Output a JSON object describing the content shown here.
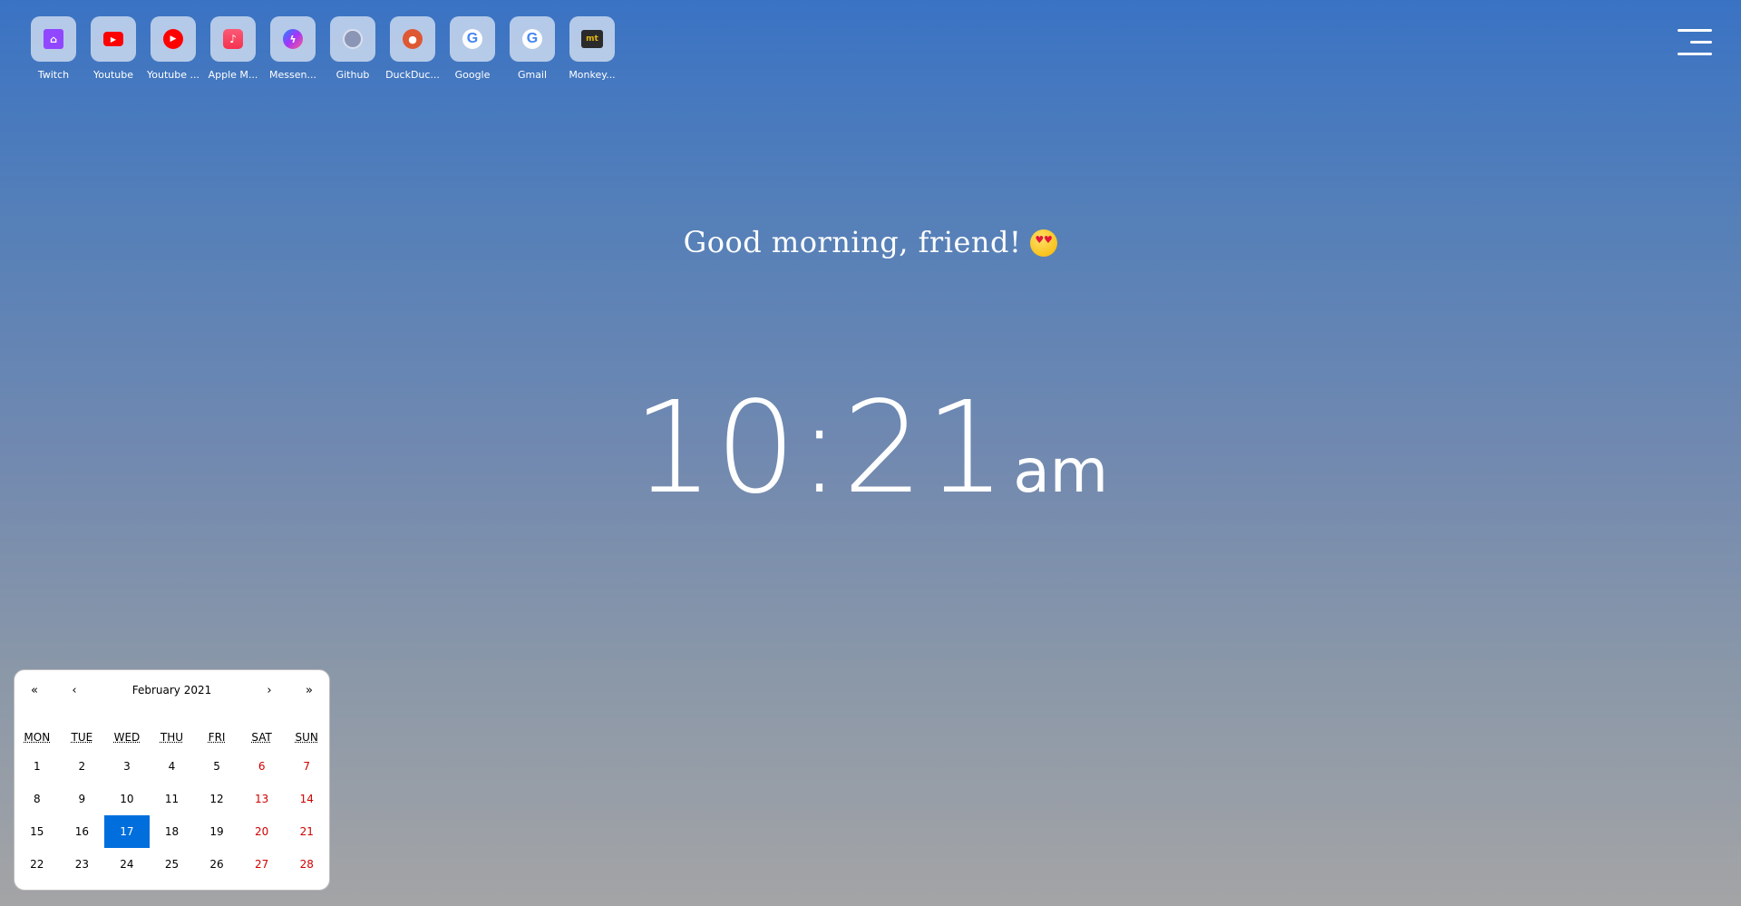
{
  "shortcuts": [
    {
      "label": "Twitch",
      "icon": "twitch-icon",
      "glyph": "⌂"
    },
    {
      "label": "Youtube",
      "icon": "youtube-icon",
      "glyph": "▶"
    },
    {
      "label": "Youtube ...",
      "icon": "youtube-music-icon",
      "glyph": "▶"
    },
    {
      "label": "Apple M...",
      "icon": "apple-music-icon",
      "glyph": "♪"
    },
    {
      "label": "Messen...",
      "icon": "messenger-icon",
      "glyph": "ϟ"
    },
    {
      "label": "Github",
      "icon": "github-icon",
      "glyph": ""
    },
    {
      "label": "DuckDuc...",
      "icon": "duckduckgo-icon",
      "glyph": "●"
    },
    {
      "label": "Google",
      "icon": "google-icon",
      "glyph": "G"
    },
    {
      "label": "Gmail",
      "icon": "gmail-icon",
      "glyph": "G"
    },
    {
      "label": "Monkey...",
      "icon": "monkeytype-icon",
      "glyph": "mt"
    }
  ],
  "greeting": "Good morning, friend!",
  "clock": {
    "time": "10:21",
    "ampm": "am"
  },
  "calendar": {
    "nav": {
      "prev_year": "«",
      "prev_month": "‹",
      "label": "February 2021",
      "next_month": "›",
      "next_year": "»"
    },
    "weekdays": [
      "MON",
      "TUE",
      "WED",
      "THU",
      "FRI",
      "SAT",
      "SUN"
    ],
    "weeks": [
      [
        "1",
        "2",
        "3",
        "4",
        "5",
        "6",
        "7"
      ],
      [
        "8",
        "9",
        "10",
        "11",
        "12",
        "13",
        "14"
      ],
      [
        "15",
        "16",
        "17",
        "18",
        "19",
        "20",
        "21"
      ],
      [
        "22",
        "23",
        "24",
        "25",
        "26",
        "27",
        "28"
      ]
    ],
    "selected_day": "17"
  },
  "colors": {
    "calendar_selected": "#006edc",
    "weekend": "#d10000"
  }
}
